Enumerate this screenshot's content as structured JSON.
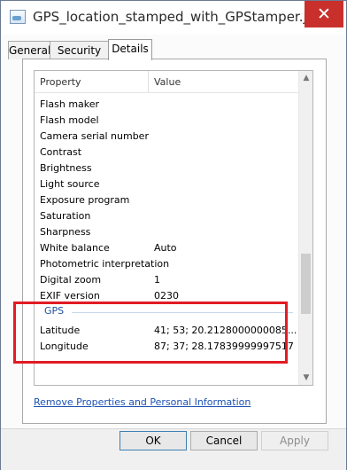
{
  "window": {
    "title": "GPS_location_stamped_with_GPStamper.jpg ...",
    "close_label": "✕"
  },
  "tabs": [
    {
      "label": "General"
    },
    {
      "label": "Security"
    },
    {
      "label": "Details",
      "active": true
    }
  ],
  "table": {
    "columns": [
      "Property",
      "Value"
    ],
    "rows": [
      {
        "property": "Flash maker",
        "value": ""
      },
      {
        "property": "Flash model",
        "value": ""
      },
      {
        "property": "Camera serial number",
        "value": ""
      },
      {
        "property": "Contrast",
        "value": ""
      },
      {
        "property": "Brightness",
        "value": ""
      },
      {
        "property": "Light source",
        "value": ""
      },
      {
        "property": "Exposure program",
        "value": ""
      },
      {
        "property": "Saturation",
        "value": ""
      },
      {
        "property": "Sharpness",
        "value": ""
      },
      {
        "property": "White balance",
        "value": "Auto"
      },
      {
        "property": "Photometric interpretation",
        "value": ""
      },
      {
        "property": "Digital zoom",
        "value": "1"
      },
      {
        "property": "EXIF version",
        "value": "0230"
      }
    ],
    "gps_group": {
      "label": "GPS",
      "rows": [
        {
          "property": "Latitude",
          "value": "41; 53; 20.2128000000085..."
        },
        {
          "property": "Longitude",
          "value": "87; 37; 28.17839999997517"
        }
      ]
    }
  },
  "remove_link": "Remove Properties and Personal Information",
  "buttons": {
    "ok": "OK",
    "cancel": "Cancel",
    "apply": "Apply"
  },
  "colors": {
    "highlight_border": "#e21b23",
    "close_button": "#c9302c",
    "link": "#1e52b3"
  },
  "icons": [
    "image-file-icon",
    "close-icon",
    "scroll-up-arrow-icon",
    "scroll-down-arrow-icon"
  ]
}
